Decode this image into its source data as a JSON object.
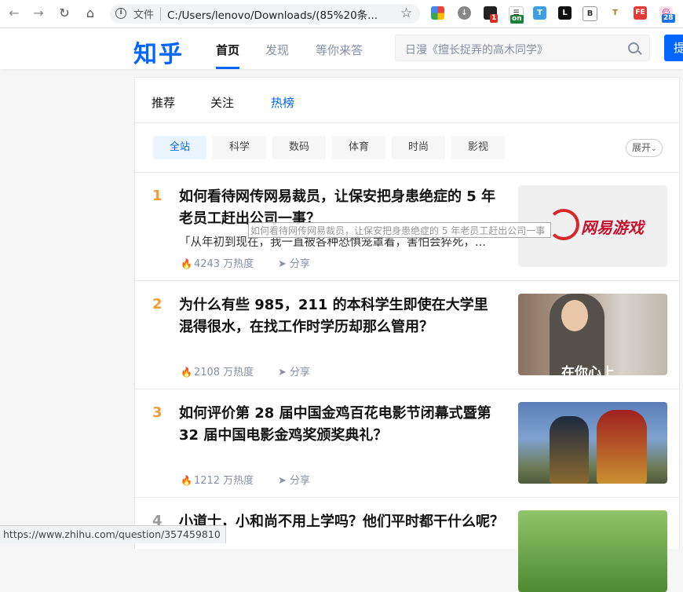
{
  "browser": {
    "file_label": "文件",
    "url": "C:/Users/lenovo/Downloads/(85%20条...",
    "ext_badge_red": "1",
    "ext_badge_green": "on",
    "ext_badge_count": "28"
  },
  "header": {
    "logo": "知乎",
    "nav": [
      "首页",
      "发现",
      "等你来答"
    ],
    "search_placeholder": "日漫《擅长捉弄的高木同学》",
    "ask_label": "提"
  },
  "feed_tabs": [
    "推荐",
    "关注",
    "热榜"
  ],
  "categories": [
    "全站",
    "科学",
    "数码",
    "体育",
    "时尚",
    "影视"
  ],
  "expand_label": "展开",
  "items": [
    {
      "rank": "1",
      "title": "如何看待网传网易裁员，让保安把身患绝症的 5 年老员工赶出公司一事？",
      "excerpt": "「从年初到现在，我一直被各种恐惧笼罩着，害怕会猝死，...",
      "heat": "4243 万热度",
      "share": "分享",
      "thumb_text": "网易游戏"
    },
    {
      "rank": "2",
      "title": "为什么有些 985，211 的本科学生即使在大学里混得很水，在找工作时学历却那么管用？",
      "heat": "2108 万热度",
      "share": "分享",
      "thumb_text": "在你心上"
    },
    {
      "rank": "3",
      "title": "如何评价第 28 届中国金鸡百花电影节闭幕式暨第 32 届中国电影金鸡奖颁奖典礼？",
      "heat": "1212 万热度",
      "share": "分享"
    },
    {
      "rank": "4",
      "title": "小道士，小和尚不用上学吗？他们平时都干什么呢？"
    }
  ],
  "tooltip": "如何看待网传网易裁员，让保安把身患绝症的 5 年老员工赶出公司一事",
  "status_url": "https://www.zhihu.com/question/357459810",
  "colors": {
    "brand": "#0066ff",
    "rank": "#f09c39"
  }
}
